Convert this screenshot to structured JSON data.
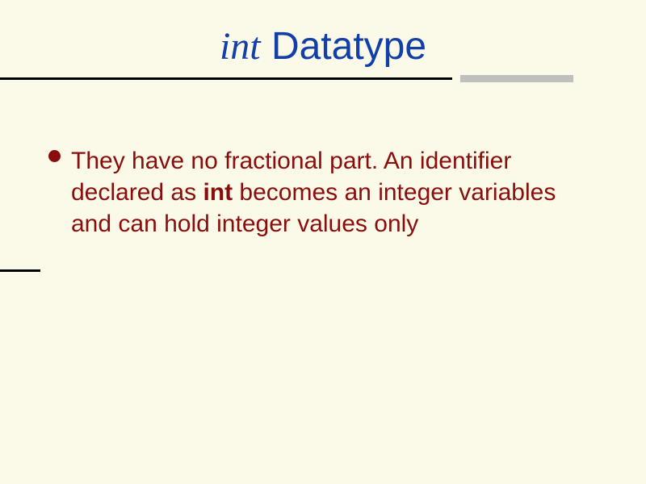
{
  "title": {
    "italic": "int",
    "rest": " Datatype"
  },
  "bullet": {
    "part1": "They have no fractional part. An identifier declared as ",
    "bold": "int",
    "part2": " becomes an integer variables and can hold integer values only"
  }
}
